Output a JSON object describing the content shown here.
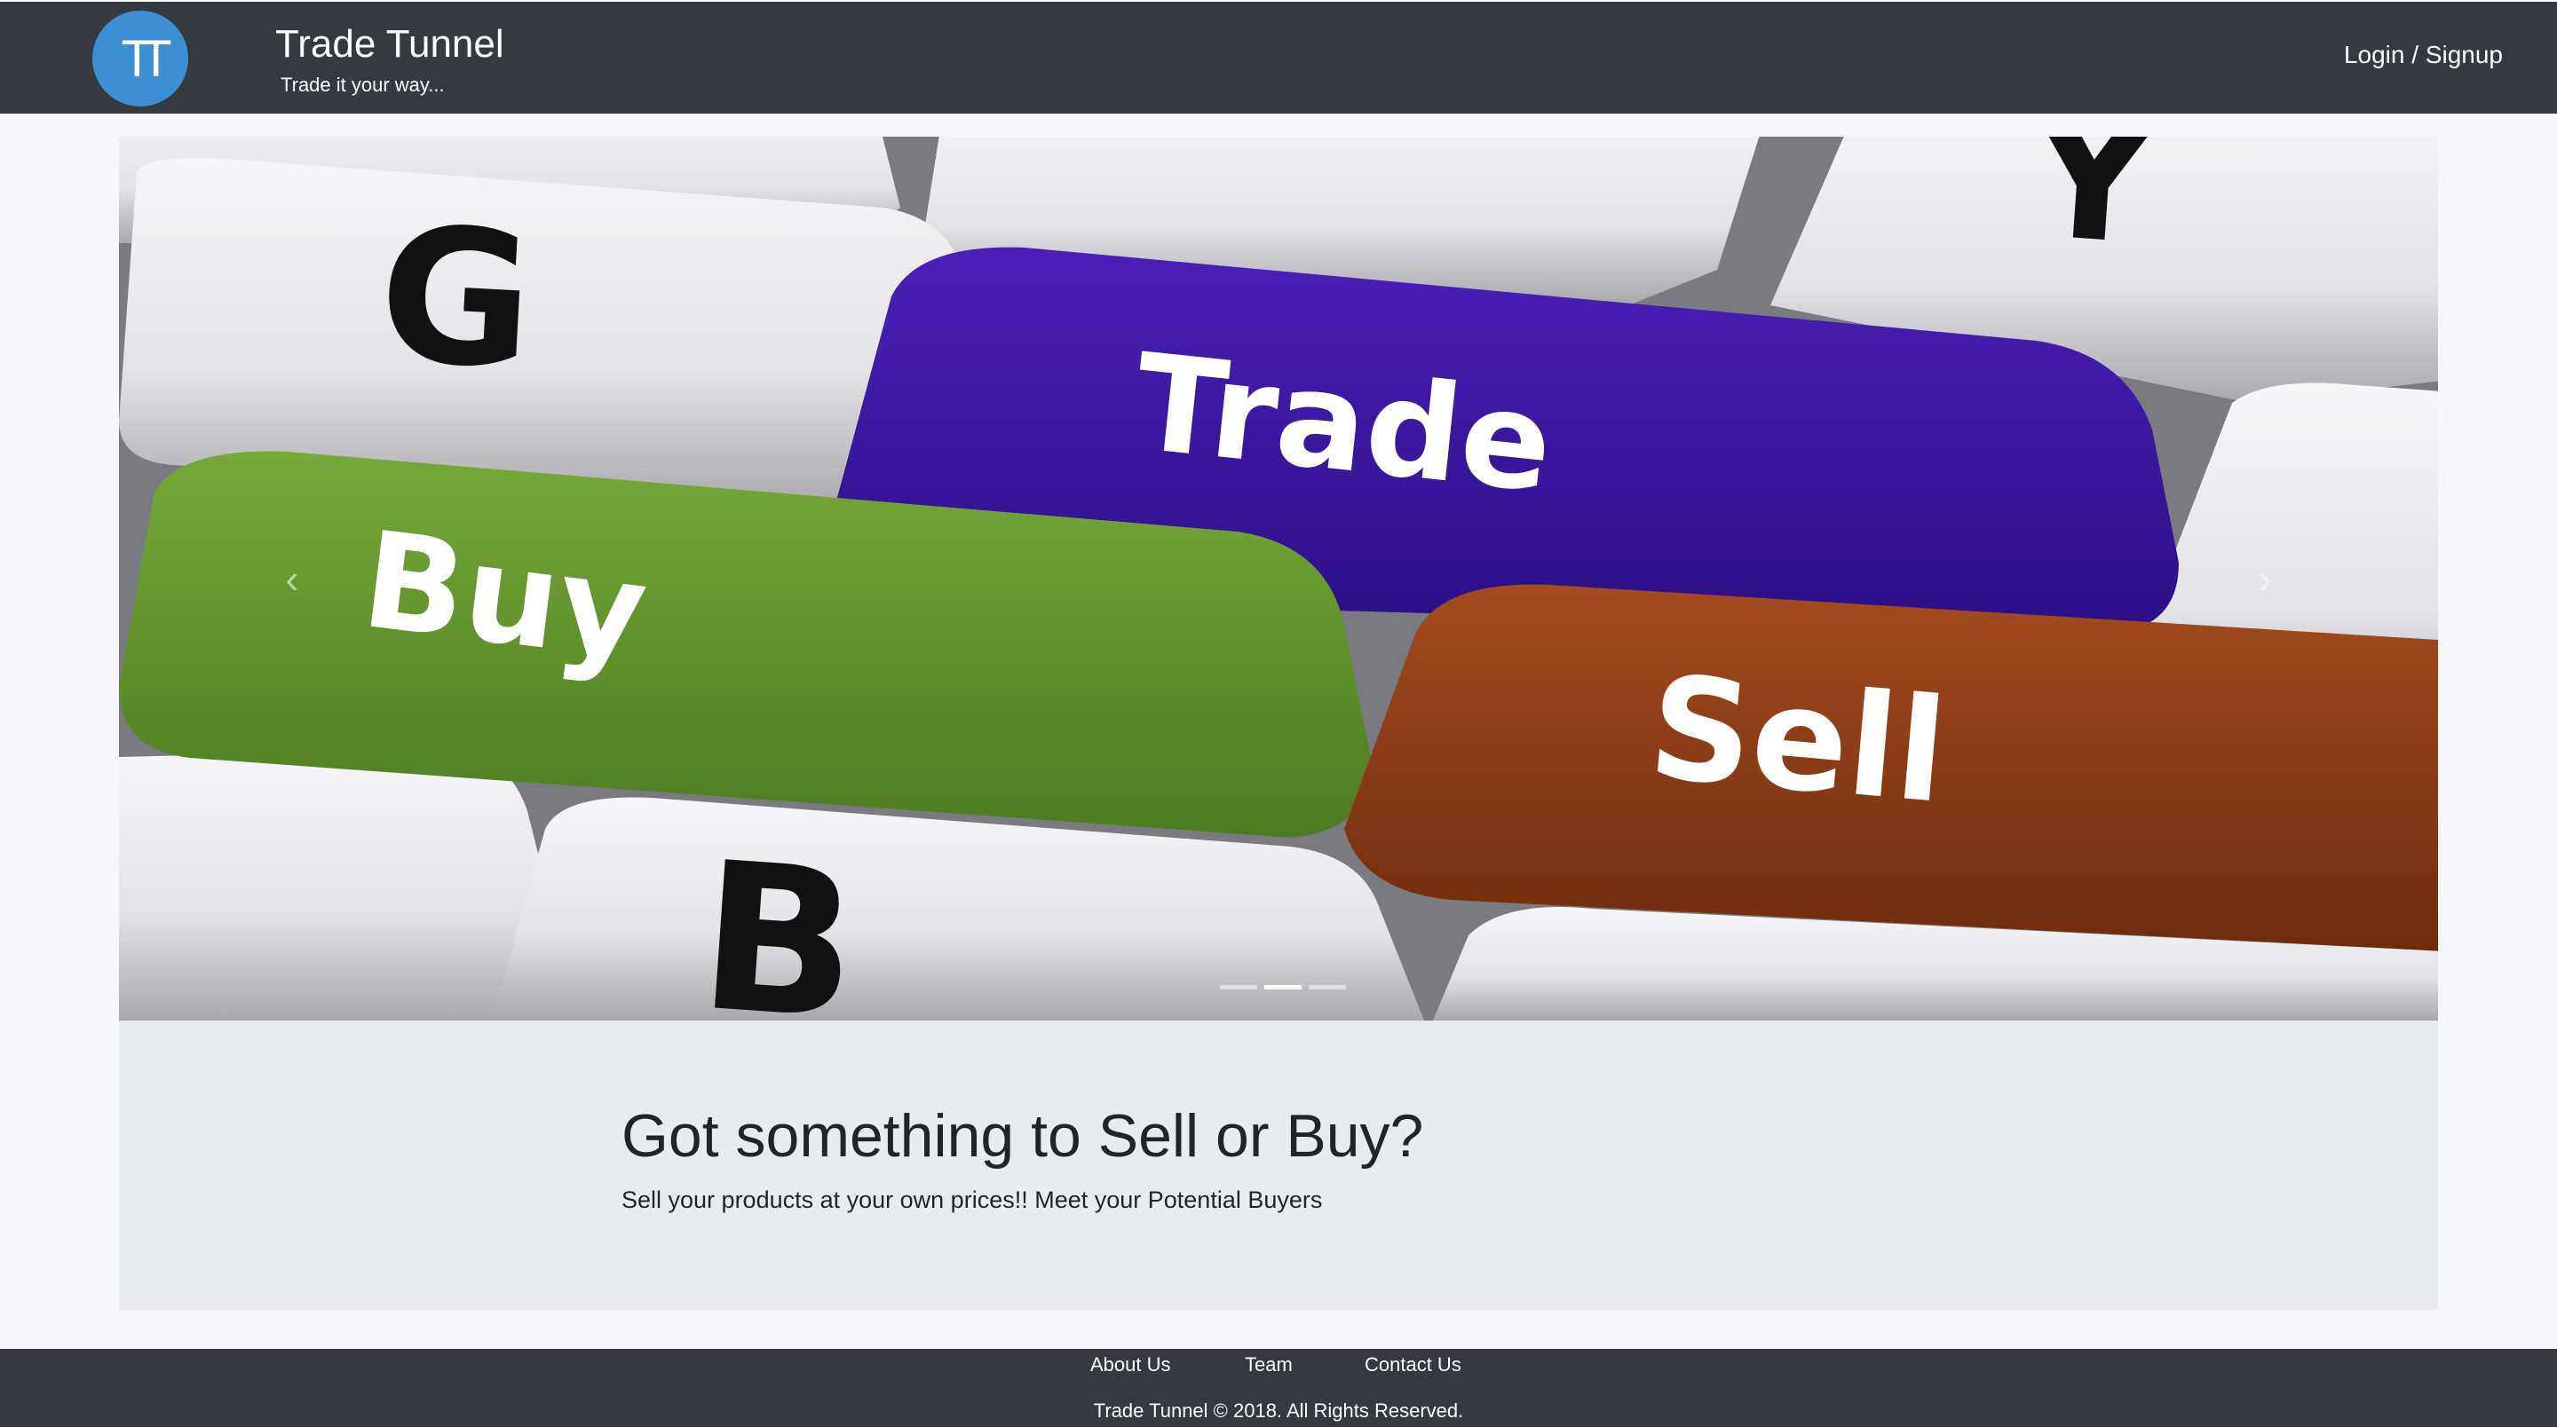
{
  "header": {
    "logo_text": "TT",
    "title": "Trade Tunnel",
    "tagline": "Trade it your way...",
    "login_label": "Login / Signup"
  },
  "carousel": {
    "prev_icon": "chevron-left-icon",
    "next_icon": "chevron-right-icon",
    "prev_glyph": "‹",
    "next_glyph": "›",
    "active_slide": 2,
    "slide_count": 3,
    "keys": {
      "trade": "Trade",
      "buy": "Buy",
      "sell": "Sell",
      "g": "G",
      "b": "B",
      "y": "Y"
    },
    "colors": {
      "trade_key": "#3b169f",
      "buy_key": "#6a9a2f",
      "sell_key": "#95431b"
    }
  },
  "hero": {
    "title": "Got something to Sell or Buy?",
    "text": "Sell your products at your own prices!! Meet your Potential Buyers"
  },
  "footer": {
    "links": [
      "About Us",
      "Team",
      "Contact Us"
    ],
    "copyright": "Trade Tunnel © 2018. All Rights Reserved."
  },
  "colors": {
    "navbar_bg": "#343a40",
    "logo_bg": "#3d8fd1",
    "jumbotron_bg": "#e9ecef",
    "page_bg": "#f7f7fb"
  }
}
